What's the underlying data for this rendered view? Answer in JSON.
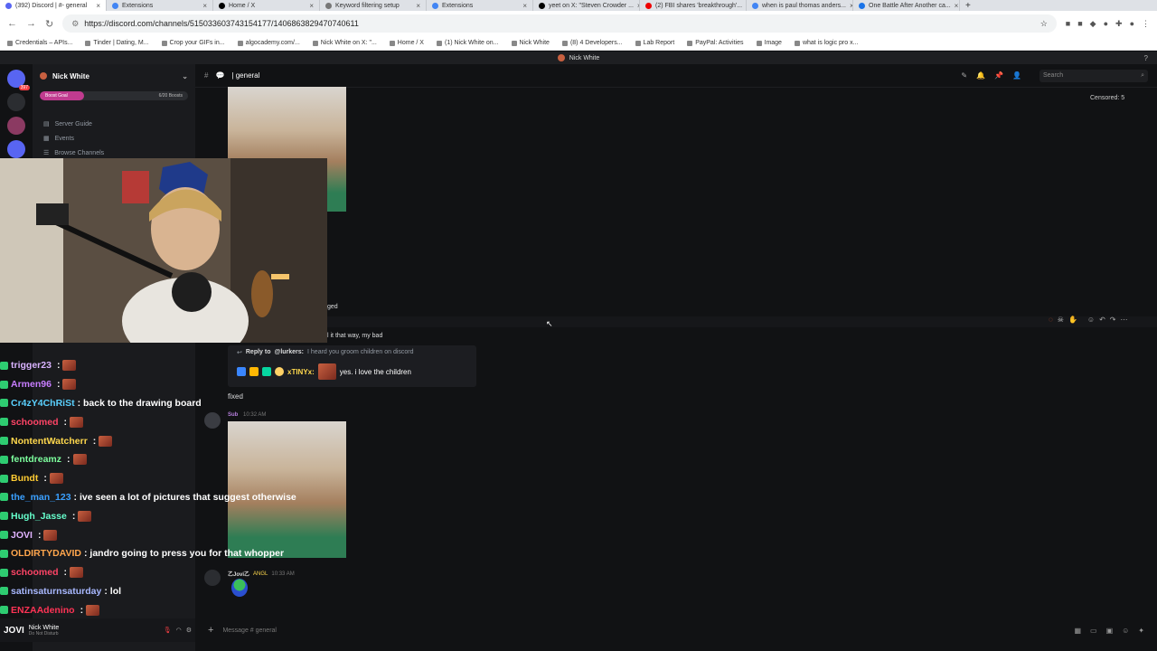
{
  "browser": {
    "tabs": [
      {
        "label": "(392) Discord | #- general",
        "active": true
      },
      {
        "label": "Extensions"
      },
      {
        "label": "Home / X"
      },
      {
        "label": "Keyword filtering setup"
      },
      {
        "label": "Extensions"
      },
      {
        "label": "yeet on X: \"Steven Crowder ..."
      },
      {
        "label": "(2) FBI shares 'breakthrough'..."
      },
      {
        "label": "when is paul thomas anders..."
      },
      {
        "label": "One Battle After Another ca..."
      }
    ],
    "new_tab": "+",
    "url": "https://discord.com/channels/515033603743154177/1406863829470740611",
    "bookmarks": [
      "Credentials – APIs...",
      "Tinder | Dating, M...",
      "Crop your GIFs in...",
      "algocademy.com/...",
      "Nick White on X: \"...",
      "Home / X",
      "(1) Nick White on...",
      "Nick White",
      "(8) 4 Developers...",
      "Lab Report",
      "PayPal: Activities",
      "Image",
      "what is logic pro x..."
    ]
  },
  "discord": {
    "top_title": "Nick White",
    "rail_badge": "397",
    "server_name": "Nick White",
    "boost": {
      "label": "Boost Goal",
      "count": "6/20 Boosts",
      "progress": 0.3
    },
    "sidebar_items": [
      "Server Guide",
      "Events",
      "Browse Channels"
    ],
    "channel_name": "| general",
    "search_placeholder": "Search",
    "censored": "Censored: 5",
    "partial_text_1": "ged",
    "partial_text_2": "l it that way, my bad",
    "reply": {
      "prefix": "Reply to",
      "user": "@lurkers:",
      "text": "I heard you groom children on discord",
      "author": "xTINYx:",
      "message": "yes. i love the children"
    },
    "message_fixed": "fixed",
    "sub_message": {
      "author": "Sub",
      "time": "10:32 AM"
    },
    "jovi_message": {
      "author": "乙Jovi乙",
      "badge": "ANGL",
      "time": "10:33 AM"
    },
    "composer_placeholder": "Message #  general",
    "user_panel": {
      "name": "Nick White",
      "status": "Do Not Disturb",
      "tag": "JOVI"
    }
  },
  "chat_overlay": [
    {
      "user": "trigger23",
      "msg": "",
      "color": "#d9b3ff"
    },
    {
      "user": "Armen96",
      "msg": "",
      "color": "#c77dff"
    },
    {
      "user": "Cr4zY4ChRiSt",
      "msg": ": back to the drawing board",
      "color": "#5ad1ff"
    },
    {
      "user": "schoomed",
      "msg": "",
      "color": "#ff4466"
    },
    {
      "user": "NontentWatcherr",
      "msg": "",
      "color": "#ffd84d"
    },
    {
      "user": "fentdreamz",
      "msg": "",
      "color": "#7dff9e"
    },
    {
      "user": "Bundt",
      "msg": "",
      "color": "#ffcc33"
    },
    {
      "user": "the_man_123",
      "msg": ": ive seen a lot of pictures that suggest otherwise",
      "color": "#3aa0ff"
    },
    {
      "user": "Hugh_Jasse",
      "msg": "",
      "color": "#66ffcc"
    },
    {
      "user": "JOVI",
      "msg": "",
      "color": "#e0b3ff"
    },
    {
      "user": "OLDIRTYDAVID",
      "msg": ": jandro going to press you for that whopper",
      "color": "#ffa64d"
    },
    {
      "user": "schoomed",
      "msg": "",
      "color": "#ff4466"
    },
    {
      "user": "satinsaturnsaturday",
      "msg": ": lol",
      "color": "#a8b8ff"
    },
    {
      "user": "ENZAAdenino",
      "msg": "",
      "color": "#ff3355"
    }
  ]
}
